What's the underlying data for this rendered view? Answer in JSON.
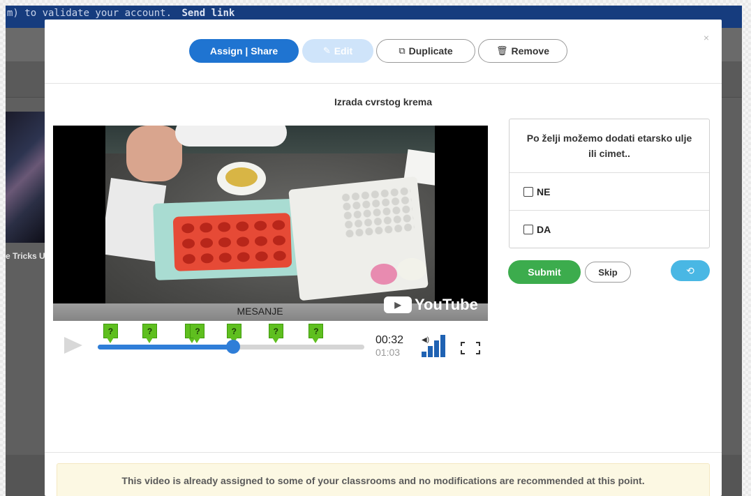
{
  "background": {
    "topbar_text": "m) to validate your account.",
    "topbar_link": "Send link",
    "under_caption": "e Tricks U"
  },
  "modal": {
    "buttons": {
      "assign_share": "Assign | Share",
      "edit": "Edit",
      "duplicate": "Duplicate",
      "remove": "Remove",
      "close": "×"
    },
    "video": {
      "title": "Izrada cvrstog krema",
      "caption": "MESANJE",
      "watermark": "YouTube",
      "current_time": "00:32",
      "total_time": "01:03",
      "progress": 0.508,
      "question_markers": [
        0.047,
        0.194,
        0.354,
        0.373,
        0.51,
        0.667,
        0.818
      ],
      "question_marker_label": "?",
      "volume_level": 1.0
    },
    "question": {
      "text": "Po želji možemo dodati etarsko ulje ili cimet..",
      "options": [
        "NE",
        "DA"
      ],
      "submit_label": "Submit",
      "skip_label": "Skip"
    },
    "notice": "This video is already assigned to some of your classrooms and no modifications are recommended at this point."
  },
  "colors": {
    "primary": "#1f74d1",
    "submit": "#3cac4d",
    "undo": "#49b7e4",
    "question_marker": "#5fbf1f",
    "notice_bg": "#fcf8e3"
  }
}
